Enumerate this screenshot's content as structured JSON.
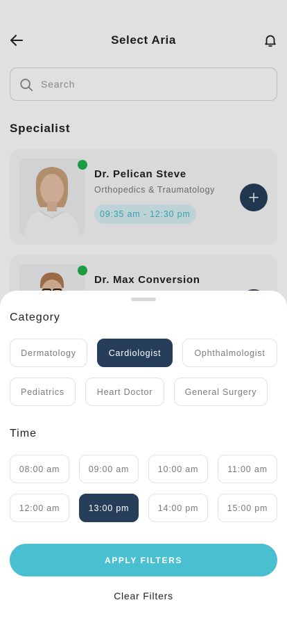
{
  "header": {
    "title": "Select Aria",
    "back_icon": "arrow-left-icon",
    "notification_icon": "bell-icon"
  },
  "search": {
    "placeholder": "Search",
    "value": ""
  },
  "specialist": {
    "section_title": "Specialist",
    "doctors": [
      {
        "name": "Dr. Pelican Steve",
        "specialty": "Orthopedics & Traumatology",
        "time": "09:35 am - 12:30 pm",
        "status": "online"
      },
      {
        "name": "Dr. Max Conversion",
        "status": "online"
      }
    ]
  },
  "filters": {
    "category_label": "Category",
    "categories": [
      {
        "label": "Dermatology",
        "selected": false
      },
      {
        "label": "Cardiologist",
        "selected": true
      },
      {
        "label": "Ophthalmologist",
        "selected": false
      },
      {
        "label": "Pediatrics",
        "selected": false
      },
      {
        "label": "Heart Doctor",
        "selected": false
      },
      {
        "label": "General Surgery",
        "selected": false
      }
    ],
    "time_label": "Time",
    "times": [
      {
        "label": "08:00 am",
        "selected": false
      },
      {
        "label": "09:00 am",
        "selected": false
      },
      {
        "label": "10:00 am",
        "selected": false
      },
      {
        "label": "11:00 am",
        "selected": false
      },
      {
        "label": "12:00 am",
        "selected": false
      },
      {
        "label": "13:00 pm",
        "selected": true
      },
      {
        "label": "14:00 pm",
        "selected": false
      },
      {
        "label": "15:00 pm",
        "selected": false
      }
    ],
    "apply_label": "APPLY FILTERS",
    "clear_label": "Clear Filters"
  },
  "colors": {
    "primary_dark": "#263e5a",
    "accent": "#49bfd0",
    "online": "#22b14c",
    "time_chip_bg": "#d9f1f4"
  }
}
